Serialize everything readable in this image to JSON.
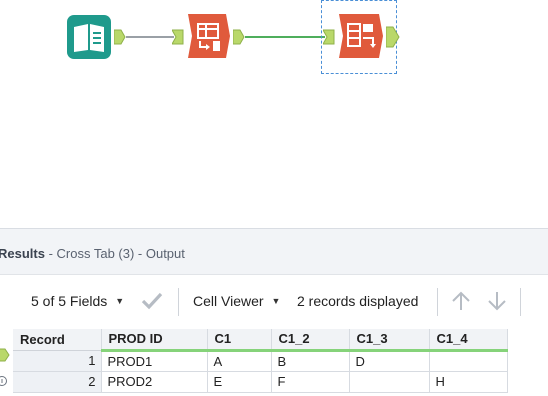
{
  "workflow": {
    "tools": [
      {
        "name": "Input Data",
        "color": "#1f9a8c"
      },
      {
        "name": "Select",
        "color": "#e05a3c"
      },
      {
        "name": "Cross Tab",
        "color": "#e05a3c"
      }
    ],
    "connection_color_1": "#9aa0a6",
    "connection_color_2": "#4fae5c",
    "anchor_color": "#b9d86a"
  },
  "results": {
    "title_bold": "Results",
    "title_rest": " - Cross Tab (3) - Output"
  },
  "toolbar": {
    "fields_label": "5 of 5 Fields",
    "cell_viewer_label": "Cell Viewer",
    "records_label": "2 records displayed"
  },
  "table": {
    "record_header": "Record",
    "columns": [
      "PROD ID",
      "C1",
      "C1_2",
      "C1_3",
      "C1_4"
    ],
    "rows": [
      {
        "record": "1",
        "cells": [
          "PROD1",
          "A",
          "B",
          "D",
          ""
        ]
      },
      {
        "record": "2",
        "cells": [
          "PROD2",
          "E",
          "F",
          "",
          "H"
        ]
      }
    ]
  }
}
